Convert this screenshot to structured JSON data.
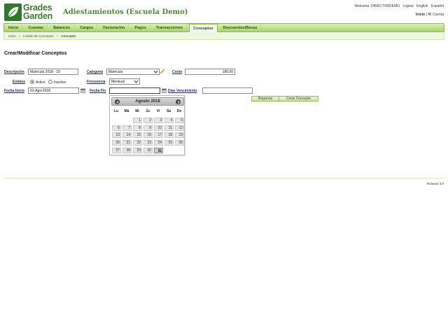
{
  "header": {
    "logo_line1": "Grades",
    "logo_line2": "Garden",
    "app_title": "Adiestamientos (Escuela Demo)",
    "welcome": "Welcome: DIRECTORDEMO",
    "logout": "Logout",
    "english": "English",
    "espanol": "Español",
    "inicio": "Inicio",
    "separator": " |",
    "mi_cuenta": "Mi Cuenta"
  },
  "nav": {
    "items": [
      "Inicio",
      "Cuentas",
      "Balances",
      "Cargos",
      "Facturación",
      "Pagos",
      "Transacciones",
      "Conceptos",
      "Descuentos/Becas"
    ],
    "active": "Conceptos"
  },
  "breadcrumb": {
    "items": [
      "Inicio",
      "Listado de Conceptos",
      "Concepto"
    ],
    "separator": ">"
  },
  "form": {
    "title": "Crear/Modificar Conceptos",
    "descripcion_label": "Descripción",
    "descripcion_value": "Matricula 2018 - 19",
    "categoria_label": "Categoría",
    "categoria_value": "Matricula",
    "costo_label": "Costo",
    "costo_value": "180.00",
    "estatus_label": "Estatus",
    "activo_label": "Activo",
    "inactivo_label": "Inactivo",
    "estatus_selected": "Activo",
    "frecuencia_label": "Frecuencia",
    "frecuencia_value": "Mensual",
    "fecha_inicio_label": "Fecha Inicio",
    "fecha_inicio_value": "01-Ago-2018",
    "fecha_fin_label": "Fecha Fin",
    "fecha_fin_value": "",
    "dias_vencimiento_label": "Dias Vencimiento",
    "dias_vencimiento_value": "",
    "regresar_button": "Regresar",
    "crear_button": "Crear Concepto"
  },
  "datepicker": {
    "title": "Agosto 2018",
    "weekdays": [
      "Lu",
      "Ma",
      "Mi",
      "Ju",
      "Vi",
      "Sá",
      "Do"
    ],
    "first_weekday_index": 2,
    "days_in_month": 31,
    "selected_day": 31
  },
  "footer": {
    "release": "Release 3.0"
  },
  "colors": {
    "brand_green": "#3b7d2e",
    "nav_green": "#a9d46a",
    "label_navy": "#1c2a55"
  }
}
